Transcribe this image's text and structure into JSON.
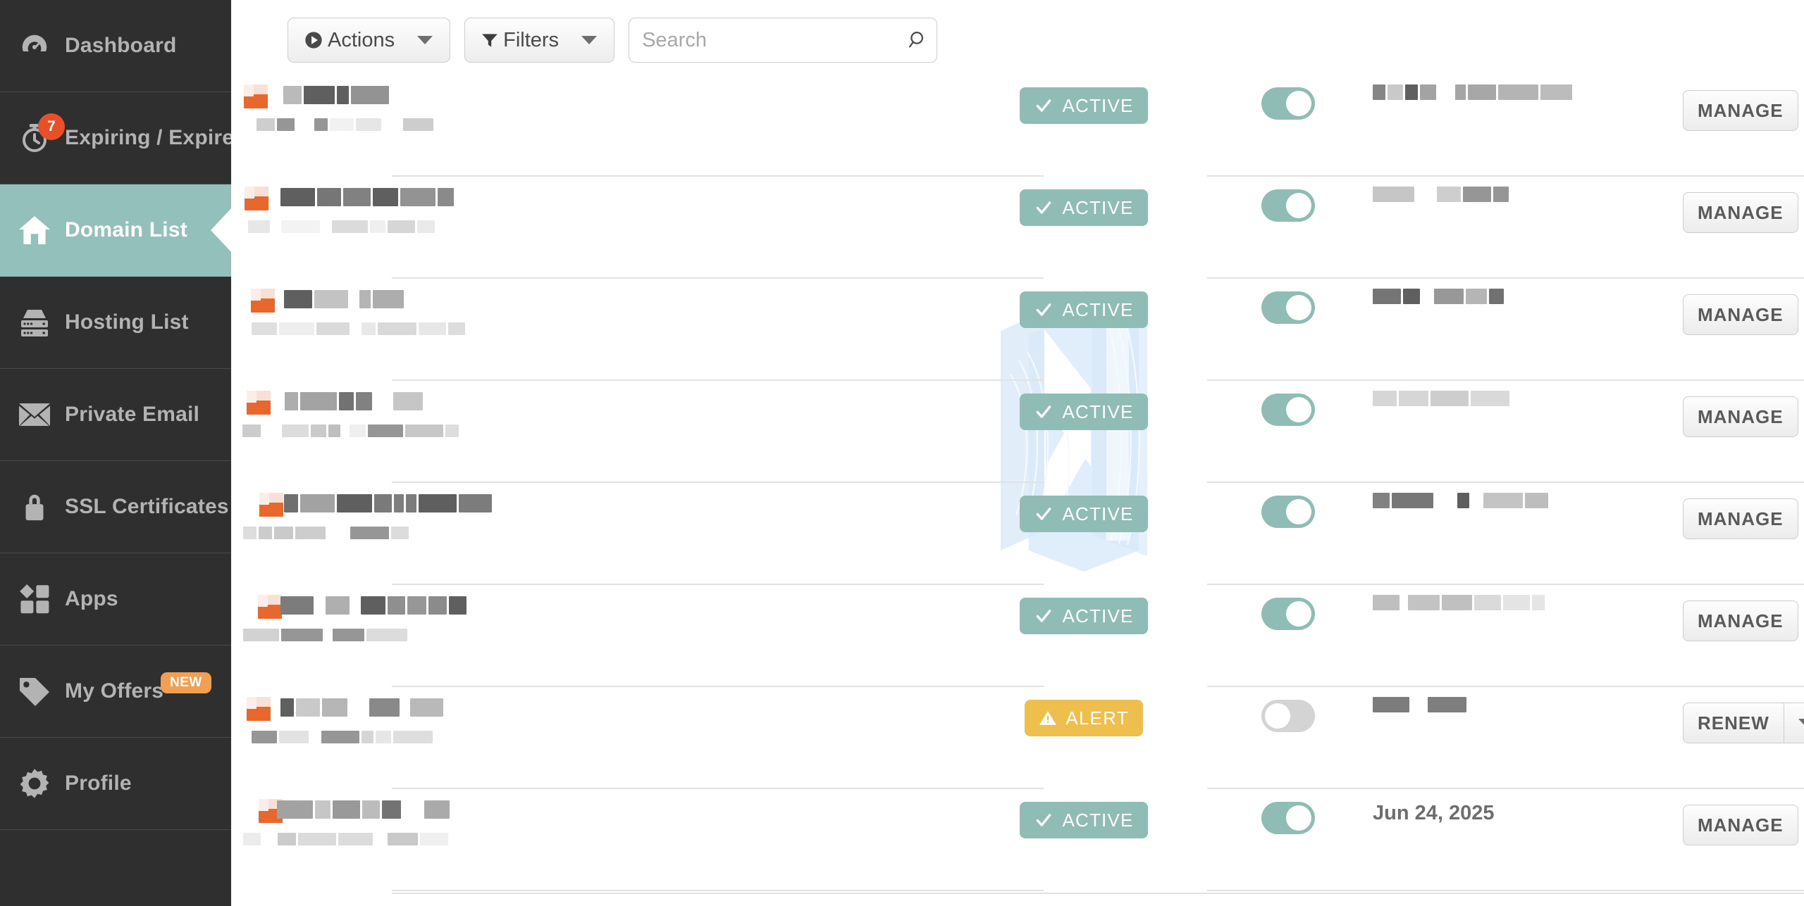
{
  "sidebar": {
    "items": [
      {
        "id": "dashboard",
        "label": "Dashboard",
        "icon": "speedometer-icon",
        "active": false
      },
      {
        "id": "expiring-expired",
        "label": "Expiring / Expired",
        "icon": "stopwatch-icon",
        "active": false,
        "count": "7"
      },
      {
        "id": "domain-list",
        "label": "Domain List",
        "icon": "home-icon",
        "active": true
      },
      {
        "id": "hosting-list",
        "label": "Hosting List",
        "icon": "server-icon",
        "active": false
      },
      {
        "id": "private-email",
        "label": "Private Email",
        "icon": "envelope-icon",
        "active": false
      },
      {
        "id": "ssl-certificates",
        "label": "SSL Certificates",
        "icon": "lock-icon",
        "active": false
      },
      {
        "id": "apps",
        "label": "Apps",
        "icon": "apps-grid-icon",
        "active": false
      },
      {
        "id": "my-offers",
        "label": "My Offers",
        "icon": "tag-icon",
        "active": false,
        "badge": "NEW"
      },
      {
        "id": "profile",
        "label": "Profile",
        "icon": "gear-icon",
        "active": false
      }
    ]
  },
  "toolbar": {
    "actions_label": "Actions",
    "filters_label": "Filters",
    "search_placeholder": "Search",
    "search_value": "",
    "search_icon": "magnifier-icon",
    "actions_icon": "play-circle-icon",
    "filters_icon": "funnel-icon",
    "caret_icon": "chevron-down-icon"
  },
  "watermark": {
    "name": "namecheap-n-logo-watermark",
    "color": "#a8cdf0"
  },
  "colors": {
    "sidebar_bg": "#2f2f2f",
    "accent_teal": "#93c0ba",
    "status_active": "#8fbcb5",
    "status_alert": "#efbf4d",
    "badge_red": "#e8502a",
    "badge_orange": "#f0a050",
    "favicon_orange": "#e8672c"
  },
  "table": {
    "rows": [
      {
        "status": "ACTIVE",
        "toggle": "on",
        "date": "",
        "date_redacted": true,
        "action": "MANAGE",
        "has_dropdown": false,
        "name_redacted": true
      },
      {
        "status": "ACTIVE",
        "toggle": "on",
        "date": "",
        "date_redacted": true,
        "action": "MANAGE",
        "has_dropdown": false,
        "name_redacted": true
      },
      {
        "status": "ACTIVE",
        "toggle": "on",
        "date": "",
        "date_redacted": true,
        "action": "MANAGE",
        "has_dropdown": false,
        "name_redacted": true
      },
      {
        "status": "ACTIVE",
        "toggle": "on",
        "date": "",
        "date_redacted": true,
        "action": "MANAGE",
        "has_dropdown": false,
        "name_redacted": true
      },
      {
        "status": "ACTIVE",
        "toggle": "on",
        "date": "",
        "date_redacted": true,
        "action": "MANAGE",
        "has_dropdown": false,
        "name_redacted": true
      },
      {
        "status": "ACTIVE",
        "toggle": "on",
        "date": "",
        "date_redacted": true,
        "action": "MANAGE",
        "has_dropdown": false,
        "name_redacted": true
      },
      {
        "status": "ALERT",
        "toggle": "off",
        "date": "",
        "date_redacted": true,
        "action": "RENEW",
        "has_dropdown": true,
        "name_redacted": true
      },
      {
        "status": "ACTIVE",
        "toggle": "on",
        "date": "Jun 24, 2025",
        "date_redacted": false,
        "action": "MANAGE",
        "has_dropdown": false,
        "name_redacted": true
      }
    ],
    "status_check_icon": "check-icon",
    "status_alert_icon": "warning-triangle-icon"
  }
}
